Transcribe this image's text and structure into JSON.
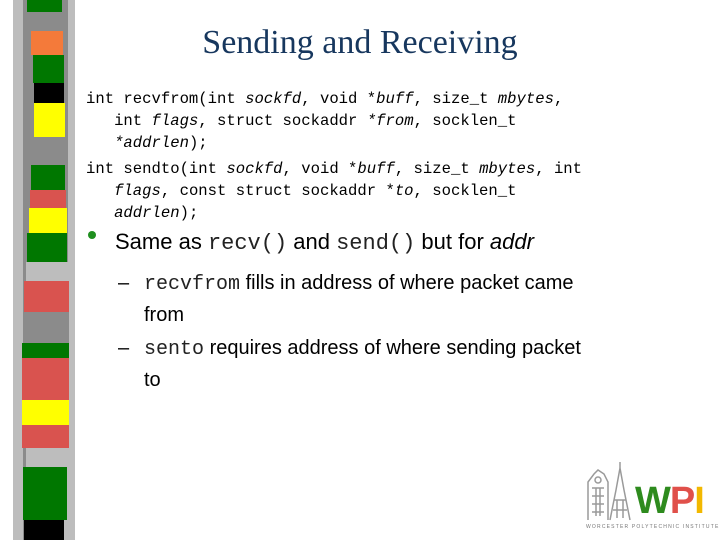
{
  "slide": {
    "title": "Sending and Receiving",
    "recvfrom_signature": [
      [
        {
          "t": "int recvfrom(int "
        },
        {
          "t": "sockfd",
          "i": true
        },
        {
          "t": ", void *"
        },
        {
          "t": "buff",
          "i": true
        },
        {
          "t": ", size_t "
        },
        {
          "t": "mbytes",
          "i": true
        },
        {
          "t": ","
        }
      ],
      [
        {
          "t": "   int "
        },
        {
          "t": "flags",
          "i": true
        },
        {
          "t": ", struct sockaddr "
        },
        {
          "t": "*from",
          "i": true
        },
        {
          "t": ", socklen_t"
        }
      ],
      [
        {
          "t": "   "
        },
        {
          "t": "*addrlen",
          "i": true
        },
        {
          "t": ");"
        }
      ]
    ],
    "sendto_signature": [
      [
        {
          "t": "int sendto(int "
        },
        {
          "t": "sockfd",
          "i": true
        },
        {
          "t": ", void *"
        },
        {
          "t": "buff",
          "i": true
        },
        {
          "t": ", size_t "
        },
        {
          "t": "mbytes",
          "i": true
        },
        {
          "t": ", int"
        }
      ],
      [
        {
          "t": "   "
        },
        {
          "t": "flags",
          "i": true
        },
        {
          "t": ", const struct sockaddr *"
        },
        {
          "t": "to",
          "i": true
        },
        {
          "t": ", socklen_t"
        }
      ],
      [
        {
          "t": "   "
        },
        {
          "t": "addrlen",
          "i": true
        },
        {
          "t": ");"
        }
      ]
    ],
    "bullet": {
      "prefix": "Same as ",
      "code1": "recv()",
      "mid": " and ",
      "code2": "send()",
      "suffix": " but for ",
      "emph": "addr"
    },
    "sub_bullets": [
      {
        "dash": "–",
        "code": "recvfrom",
        "text_line1": " fills in address of where packet came",
        "text_line2": "from"
      },
      {
        "dash": "–",
        "code": "sento",
        "text_line1": " requires address of where sending packet",
        "text_line2": "to"
      }
    ],
    "logo": {
      "letters": [
        "W",
        "P",
        "I"
      ],
      "tagline": "WORCESTER POLYTECHNIC INSTITUTE"
    }
  },
  "colors": {
    "title": "#17375e",
    "bullet": "#1f8f1f",
    "logo_w": "#2e8b1e",
    "logo_p": "#e0504a",
    "logo_i": "#f2b800",
    "strip_blocks": [
      "#007700",
      "#f47a3a",
      "#007700",
      "#000000",
      "#ffff00",
      "#007700",
      "#d9534f",
      "#ffff00",
      "#007700",
      "#d9534f",
      "#8b8b8b",
      "#007700",
      "#d9534f",
      "#ffff00",
      "#d9534f",
      "#007700",
      "#000000"
    ]
  }
}
